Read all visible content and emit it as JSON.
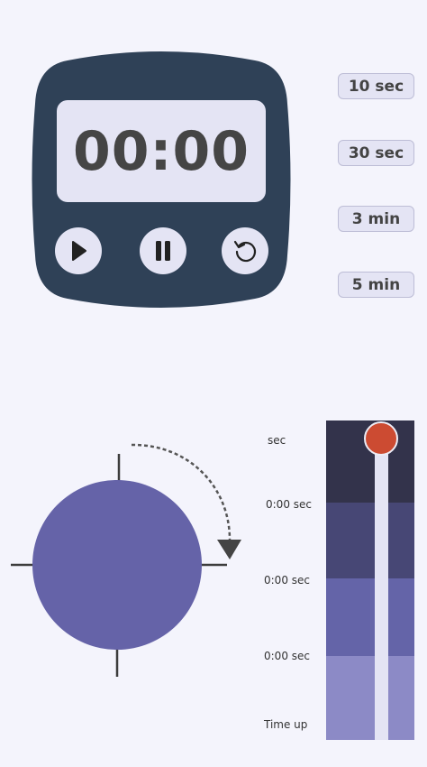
{
  "timer": {
    "display": "00:00"
  },
  "presets": [
    {
      "label": "10 sec"
    },
    {
      "label": "30 sec"
    },
    {
      "label": "3 min"
    },
    {
      "label": "5 min"
    }
  ],
  "timeline": {
    "labels": [
      "sec",
      "0:00 sec",
      "0:00 sec",
      "0:00 sec",
      "Time up"
    ],
    "slider_value": 0
  },
  "colors": {
    "device_body": "#2f4157",
    "lcd": "#e4e4f4",
    "dial": "#6563a8",
    "band_1": "#33334b",
    "band_2": "#474775",
    "band_3": "#6464a8",
    "band_4": "#8c8ac6",
    "handle": "#cc4b32"
  }
}
